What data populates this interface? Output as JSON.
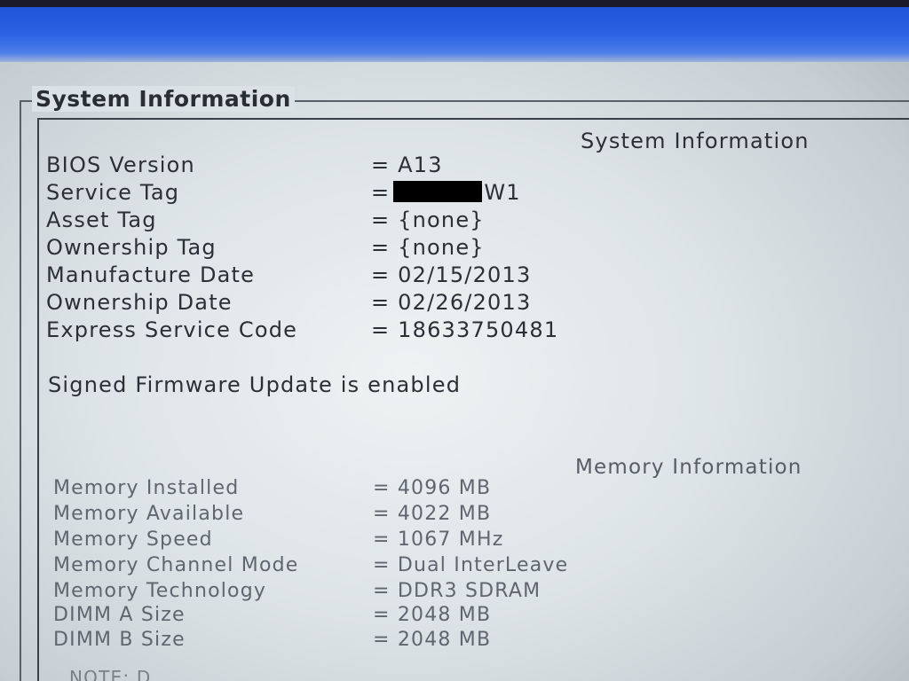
{
  "section_title": "System Information",
  "system": {
    "heading": "System Information",
    "rows": [
      {
        "label": "BIOS Version",
        "value": "= A13"
      },
      {
        "label": "Service Tag",
        "value_prefix": "=",
        "value_suffix": "W1"
      },
      {
        "label": "Asset Tag",
        "value": "= {none}"
      },
      {
        "label": "Ownership Tag",
        "value": "= {none}"
      },
      {
        "label": "Manufacture Date",
        "value": "= 02/15/2013"
      },
      {
        "label": "Ownership Date",
        "value": "= 02/26/2013"
      },
      {
        "label": "Express Service Code",
        "value": "= 18633750481"
      }
    ],
    "signed_firmware": "Signed Firmware Update is enabled"
  },
  "memory": {
    "heading": "Memory Information",
    "rows": [
      {
        "label": "Memory Installed",
        "value": "= 4096 MB"
      },
      {
        "label": "Memory Available",
        "value": "= 4022 MB"
      },
      {
        "label": "Memory Speed",
        "value": "= 1067 MHz"
      },
      {
        "label": "Memory Channel Mode",
        "value": "= Dual InterLeave"
      },
      {
        "label": "Memory Technology",
        "value": "= DDR3 SDRAM"
      },
      {
        "label": "DIMM A Size",
        "value": "= 2048 MB"
      },
      {
        "label": "DIMM B Size",
        "value": "= 2048 MB"
      }
    ]
  },
  "note_fragment": "NOTE: D",
  "colors": {
    "title_bar": "#2c62e4",
    "text": "#2b2f36",
    "memory_text": "#5f666f"
  }
}
